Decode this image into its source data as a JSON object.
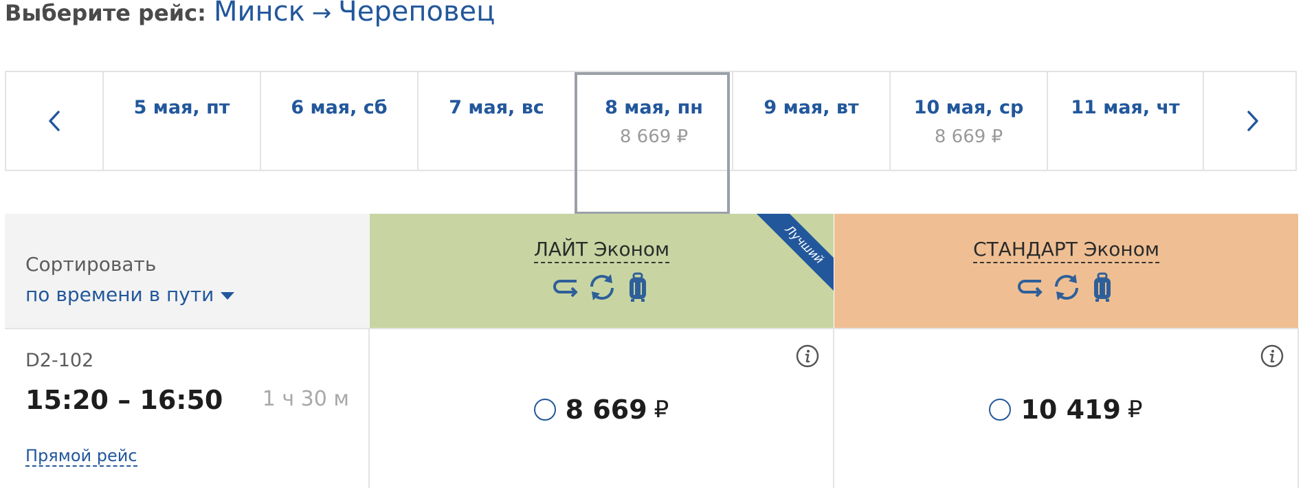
{
  "header": {
    "label": "Выберите рейс:",
    "from": "Минск",
    "arrow": "→",
    "to": "Череповец"
  },
  "dates": [
    {
      "label": "5 мая, пт",
      "price": ""
    },
    {
      "label": "6 мая, сб",
      "price": ""
    },
    {
      "label": "7 мая, вс",
      "price": ""
    },
    {
      "label": "8 мая, пн",
      "price": "8 669 ₽",
      "selected": true
    },
    {
      "label": "9 мая, вт",
      "price": ""
    },
    {
      "label": "10 мая, ср",
      "price": "8 669 ₽"
    },
    {
      "label": "11 мая, чт",
      "price": ""
    }
  ],
  "nav": {
    "prev_icon": "chevron-left-icon",
    "next_icon": "chevron-right-icon"
  },
  "sort": {
    "title": "Сортировать",
    "value": "по времени в пути"
  },
  "fares": [
    {
      "name": "ЛАЙТ Эконом",
      "ribbon": "Лучший",
      "color": "#c8d5a2",
      "icons": [
        "return-arrow-icon",
        "exchange-icon",
        "baggage-icon"
      ]
    },
    {
      "name": "СТАНДАРТ Эконом",
      "ribbon": "",
      "color": "#efbf93",
      "icons": [
        "return-arrow-icon",
        "exchange-icon",
        "baggage-icon"
      ]
    }
  ],
  "flight": {
    "number": "D2-102",
    "time": "15:20 – 16:50",
    "duration": "1 ч 30 м",
    "type": "Прямой рейс",
    "prices": [
      {
        "value": "8 669",
        "currency": "₽"
      },
      {
        "value": "10 419",
        "currency": "₽"
      }
    ]
  },
  "colors": {
    "accent": "#22579b",
    "muted": "#9a9a9a",
    "border": "#e3e3e3"
  }
}
